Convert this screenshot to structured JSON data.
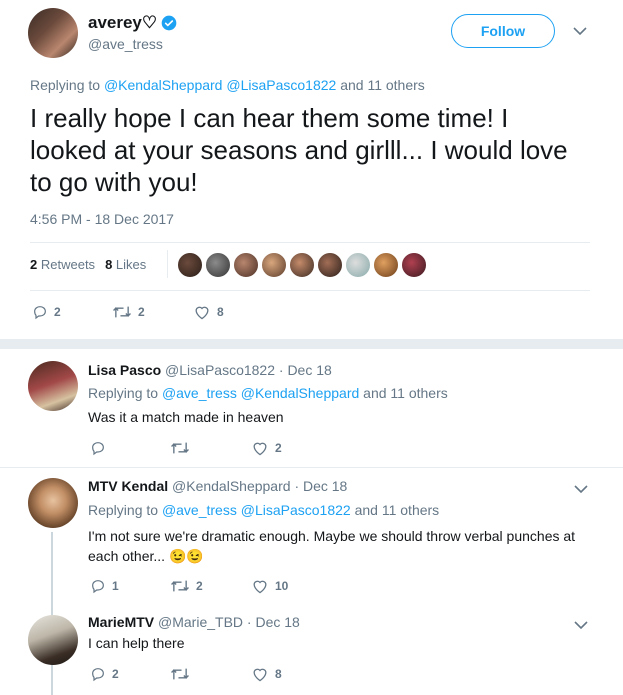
{
  "main_tweet": {
    "display_name": "averey♡",
    "handle": "@ave_tress",
    "follow_label": "Follow",
    "replying_prefix": "Replying to",
    "replying_mention_1": "@KendalSheppard",
    "replying_mention_2": "@LisaPasco1822",
    "replying_suffix": "and 11 others",
    "text": "I really hope I can hear them some time! I looked at your seasons and girlll... I would love to go with you!",
    "timestamp": "4:56 PM - 18 Dec 2017",
    "retweets_count": "2",
    "retweets_label": "Retweets",
    "likes_count": "8",
    "likes_label": "Likes",
    "reply_count": "2",
    "retweet_action_count": "2",
    "like_action_count": "8"
  },
  "replies": [
    {
      "display_name": "Lisa Pasco",
      "handle": "@LisaPasco1822",
      "date": "· Dec 18",
      "replying_prefix": "Replying to",
      "mention_1": "@ave_tress",
      "mention_2": "@KendalSheppard",
      "suffix": "and 11 others",
      "text": "Was it a match made in heaven",
      "reply_count": "",
      "retweet_count": "",
      "like_count": "2"
    },
    {
      "display_name": "MTV Kendal",
      "handle": "@KendalSheppard",
      "date": "· Dec 18",
      "replying_prefix": "Replying to",
      "mention_1": "@ave_tress",
      "mention_2": "@LisaPasco1822",
      "suffix": "and 11 others",
      "text": "I'm not sure we're dramatic enough. Maybe we should throw verbal punches at each other...",
      "emoji": "😉😉",
      "reply_count": "1",
      "retweet_count": "2",
      "like_count": "10"
    },
    {
      "display_name": "MarieMTV",
      "handle": "@Marie_TBD",
      "date": "· Dec 18",
      "text": "I can help there",
      "reply_count": "2",
      "retweet_count": "",
      "like_count": "8"
    }
  ],
  "colors": {
    "accent": "#1da1f2",
    "muted": "#657786",
    "divider": "#e6ecf0"
  },
  "icons": [
    "verified-badge-icon",
    "chevron-down-icon",
    "reply-icon",
    "retweet-icon",
    "like-icon"
  ]
}
